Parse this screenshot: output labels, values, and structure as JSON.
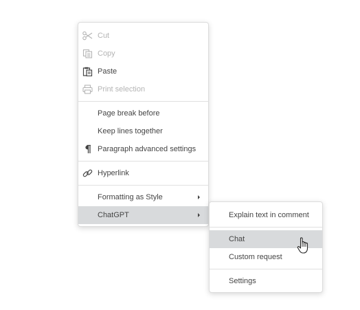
{
  "context_menu": {
    "items": [
      {
        "label": "Cut",
        "icon": "scissors-icon",
        "enabled": false
      },
      {
        "label": "Copy",
        "icon": "copy-icon",
        "enabled": false
      },
      {
        "label": "Paste",
        "icon": "paste-icon",
        "enabled": true
      },
      {
        "label": "Print selection",
        "icon": "printer-icon",
        "enabled": false
      },
      {
        "label": "Page break before",
        "enabled": true
      },
      {
        "label": "Keep lines together",
        "enabled": true
      },
      {
        "label": "Paragraph advanced settings",
        "icon": "pilcrow-icon",
        "enabled": true
      },
      {
        "label": "Hyperlink",
        "icon": "link-icon",
        "enabled": true
      },
      {
        "label": "Formatting as Style",
        "has_submenu": true,
        "enabled": true
      },
      {
        "label": "ChatGPT",
        "has_submenu": true,
        "enabled": true,
        "highlighted": true
      }
    ]
  },
  "chatgpt_submenu": {
    "items": [
      {
        "label": "Explain text in comment"
      },
      {
        "label": "Chat",
        "highlighted": true
      },
      {
        "label": "Custom request"
      },
      {
        "label": "Settings"
      }
    ]
  },
  "colors": {
    "text": "#444444",
    "disabled_text": "#b4b4b4",
    "highlight": "#d8dadc",
    "separator": "#e0e0e0"
  }
}
